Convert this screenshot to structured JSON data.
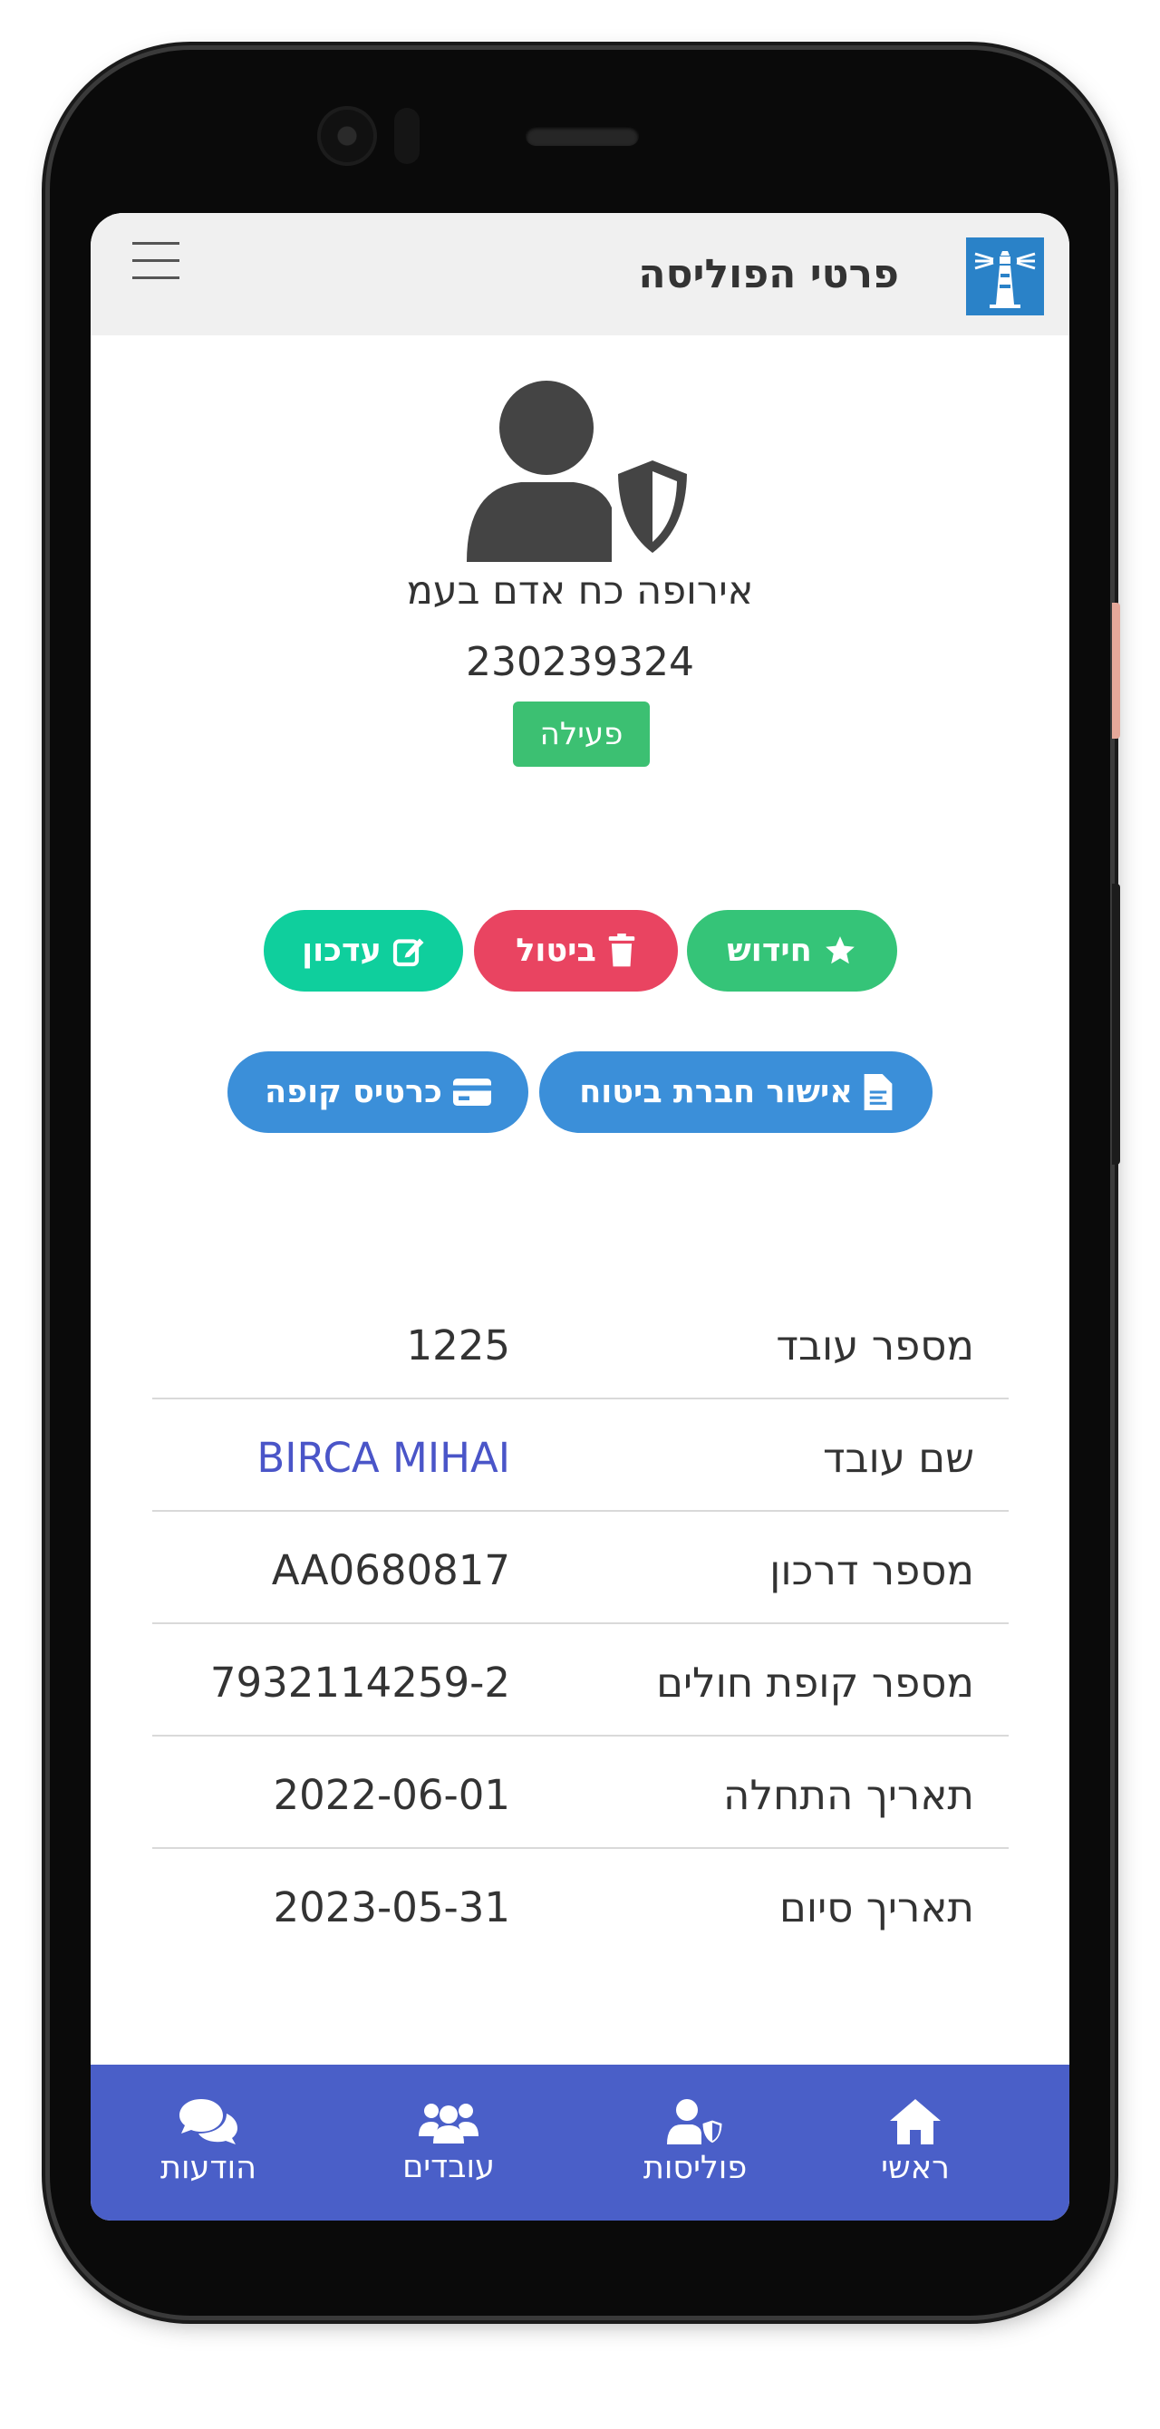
{
  "header": {
    "title": "פרטי הפוליסה"
  },
  "policy": {
    "company": "אירופה כח אדם בעמ",
    "number": "230239324",
    "status": "פעילה"
  },
  "actions": {
    "renew_label": "חידוש",
    "cancel_label": "ביטול",
    "update_label": "עדכון",
    "insurer_approval_label": "אישור חברת ביטוח",
    "fund_card_label": "כרטיס קופה"
  },
  "details": [
    {
      "label": "מספר עובד",
      "value": "1225"
    },
    {
      "label": "שם עובד",
      "value": "BIRCA MIHAI"
    },
    {
      "label": "מספר דרכון",
      "value": "AA0680817"
    },
    {
      "label": "מספר קופת חולים",
      "value": "7932114259-2"
    },
    {
      "label": "תאריך התחלה",
      "value": "2022-06-01"
    },
    {
      "label": "תאריך סיום",
      "value": "2023-05-31"
    }
  ],
  "bottom_nav": {
    "home": "ראשי",
    "policies": "פוליסות",
    "workers": "עובדים",
    "messages": "הודעות"
  },
  "colors": {
    "renew": "#35c478",
    "cancel": "#e94461",
    "update": "#0fcf9d",
    "info": "#3b8fd9",
    "status_active": "#3cc072",
    "nav_bg": "#4a5fc8",
    "logo_bg": "#2a82c8"
  },
  "icons": {
    "logo": "lighthouse-icon",
    "menu": "hamburger-icon",
    "avatar": "user-shield-icon",
    "renew": "star-icon",
    "cancel": "trash-icon",
    "update": "edit-icon",
    "insurer_approval": "file-invoice-icon",
    "fund_card": "credit-card-icon",
    "home": "home-icon",
    "policies": "user-shield-icon",
    "workers": "users-icon",
    "messages": "comments-icon"
  }
}
